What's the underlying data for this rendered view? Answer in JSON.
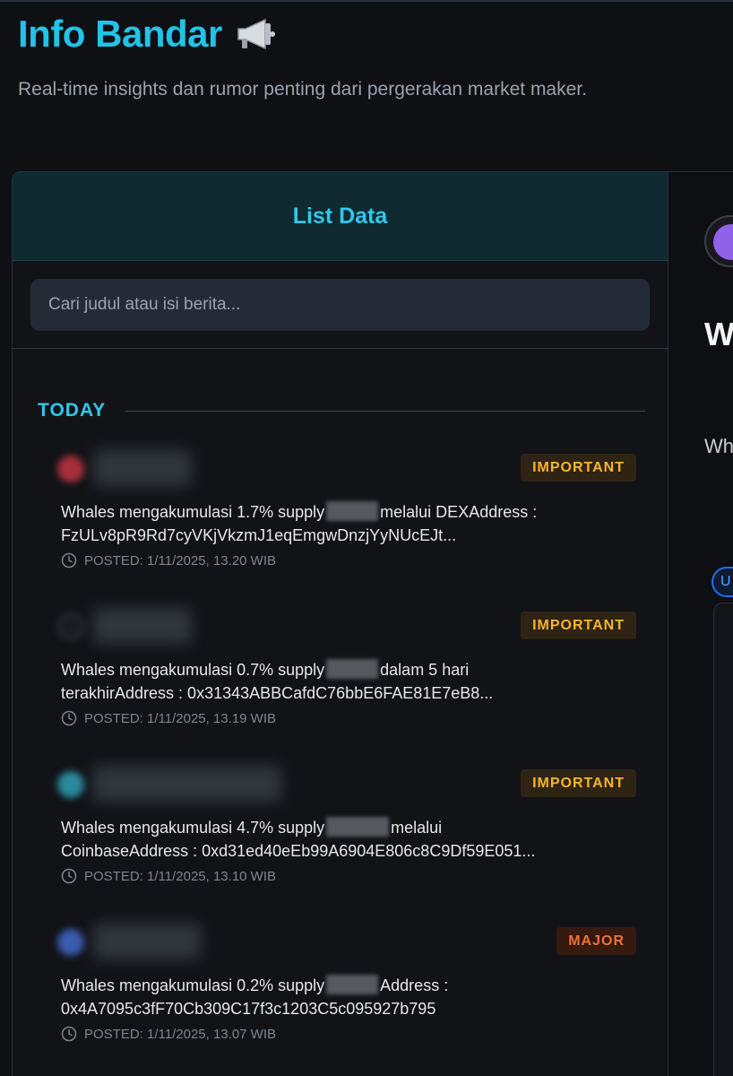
{
  "header": {
    "title": "Info Bandar",
    "subtitle": "Real-time insights dan rumor penting dari pergerakan market maker."
  },
  "panel": {
    "title": "List Data",
    "search_placeholder": "Cari judul atau isi berita...",
    "section_label": "TODAY"
  },
  "items": [
    {
      "badge": "IMPORTANT",
      "line1_a": "Whales mengakumulasi 1.7% supply",
      "line1_b": "melalui DEXAddress :",
      "line2": "FzULv8pR9Rd7cyVKjVkzmJ1eqEmgwDnzjYyNUcEJt...",
      "posted": "POSTED: 1/11/2025, 13.20 WIB"
    },
    {
      "badge": "IMPORTANT",
      "line1_a": "Whales mengakumulasi 0.7% supply",
      "line1_b": "dalam 5 hari",
      "line2": "terakhirAddress : 0x31343ABBCafdC76bbE6FAE81E7eB8...",
      "posted": "POSTED: 1/11/2025, 13.19 WIB"
    },
    {
      "badge": "IMPORTANT",
      "line1_a": "Whales mengakumulasi 4.7% supply",
      "line1_b": "melalui",
      "line2": "CoinbaseAddress : 0xd31ed40eEb99A6904E806c8C9Df59E051...",
      "posted": "POSTED: 1/11/2025, 13.10 WIB"
    },
    {
      "badge": "MAJOR",
      "line1_a": "Whales mengakumulasi 0.2% supply",
      "line1_b": "Address :",
      "line2": "0x4A7095c3fF70Cb309C17f3c1203C5c095927b795",
      "posted": "POSTED: 1/11/2025, 13.07 WIB"
    }
  ],
  "right": {
    "heading": "W m",
    "text": "Wh",
    "chip": "U"
  },
  "colors": {
    "accent": "#22c3e6",
    "important": "#f5b52e",
    "major": "#f0713a"
  }
}
